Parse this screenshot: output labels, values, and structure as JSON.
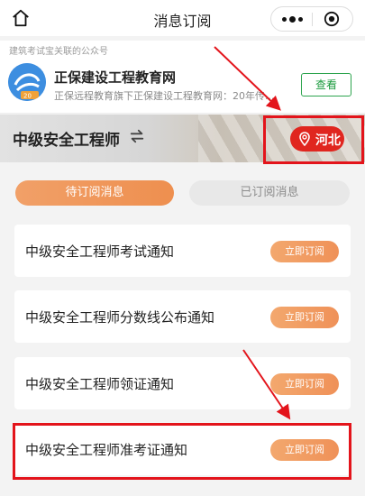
{
  "header": {
    "title": "消息订阅",
    "home_icon": "home-icon",
    "more_icon": "more-dots-icon",
    "close_icon": "close-circle-icon"
  },
  "official_account": {
    "note": "建筑考试宝关联的公众号",
    "name": "正保建设工程教育网",
    "description": "正保远程教育旗下正保建设工程教育网：20年传...",
    "logo_text": "20",
    "view_label": "查看"
  },
  "banner": {
    "exam_title": "中级安全工程师",
    "switch_icon": "swap-icon",
    "region_label": "河北",
    "region_icon": "location-pin-icon"
  },
  "tabs": {
    "pending_label": "待订阅消息",
    "subscribed_label": "已订阅消息"
  },
  "notifications": [
    {
      "title": "中级安全工程师考试通知",
      "action": "立即订阅"
    },
    {
      "title": "中级安全工程师分数线公布通知",
      "action": "立即订阅"
    },
    {
      "title": "中级安全工程师领证通知",
      "action": "立即订阅"
    },
    {
      "title": "中级安全工程师准考证通知",
      "action": "立即订阅"
    }
  ],
  "colors": {
    "accent_orange": "#ef9158",
    "region_red": "#e0261f",
    "annotation_red": "#e3141b",
    "view_green": "#2da44e"
  }
}
